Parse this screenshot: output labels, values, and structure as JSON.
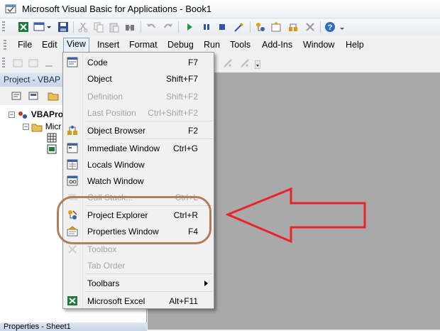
{
  "window": {
    "title": "Microsoft Visual Basic for Applications - Book1"
  },
  "menubar": {
    "items": [
      {
        "label": "File",
        "key": "file"
      },
      {
        "label": "Edit",
        "key": "edit"
      },
      {
        "label": "View",
        "key": "view"
      },
      {
        "label": "Insert",
        "key": "insert"
      },
      {
        "label": "Format",
        "key": "format"
      },
      {
        "label": "Debug",
        "key": "debug"
      },
      {
        "label": "Run",
        "key": "run"
      },
      {
        "label": "Tools",
        "key": "tools"
      },
      {
        "label": "Add-Ins",
        "key": "addins"
      },
      {
        "label": "Window",
        "key": "window"
      },
      {
        "label": "Help",
        "key": "help"
      }
    ]
  },
  "project_panel": {
    "title": "Project - VBAP",
    "tree": {
      "root": "VBAPro",
      "child": "Micr"
    }
  },
  "properties_panel": {
    "title": "Properties - Sheet1"
  },
  "view_menu": {
    "items": [
      {
        "label": "Code",
        "shortcut": "F7",
        "icon": "code-icon",
        "disabled": false
      },
      {
        "label": "Object",
        "shortcut": "Shift+F7",
        "icon": "",
        "disabled": false
      },
      {
        "label": "Definition",
        "shortcut": "Shift+F2",
        "icon": "",
        "disabled": true
      },
      {
        "label": "Last Position",
        "shortcut": "Ctrl+Shift+F2",
        "icon": "",
        "disabled": true
      },
      {
        "label": "Object Browser",
        "shortcut": "F2",
        "icon": "object-browser-icon",
        "disabled": false
      },
      {
        "label": "Immediate Window",
        "shortcut": "Ctrl+G",
        "icon": "immediate-window-icon",
        "disabled": false
      },
      {
        "label": "Locals Window",
        "shortcut": "",
        "icon": "locals-window-icon",
        "disabled": false
      },
      {
        "label": "Watch Window",
        "shortcut": "",
        "icon": "watch-window-icon",
        "disabled": false
      },
      {
        "label": "Call Stack...",
        "shortcut": "Ctrl+L",
        "icon": "call-stack-icon",
        "disabled": true
      },
      {
        "label": "Project Explorer",
        "shortcut": "Ctrl+R",
        "icon": "project-explorer-icon",
        "disabled": false
      },
      {
        "label": "Properties Window",
        "shortcut": "F4",
        "icon": "properties-window-icon",
        "disabled": false
      },
      {
        "label": "Toolbox",
        "shortcut": "",
        "icon": "toolbox-icon",
        "disabled": true
      },
      {
        "label": "Tab Order",
        "shortcut": "",
        "icon": "",
        "disabled": true
      },
      {
        "label": "Toolbars",
        "shortcut": "",
        "icon": "",
        "disabled": false
      },
      {
        "label": "Microsoft Excel",
        "shortcut": "Alt+F11",
        "icon": "excel-icon",
        "disabled": false
      }
    ]
  },
  "colors": {
    "annotation_oval": "#b27e5a",
    "annotation_arrow": "#e8232a",
    "workspace": "#a9a9a9"
  }
}
